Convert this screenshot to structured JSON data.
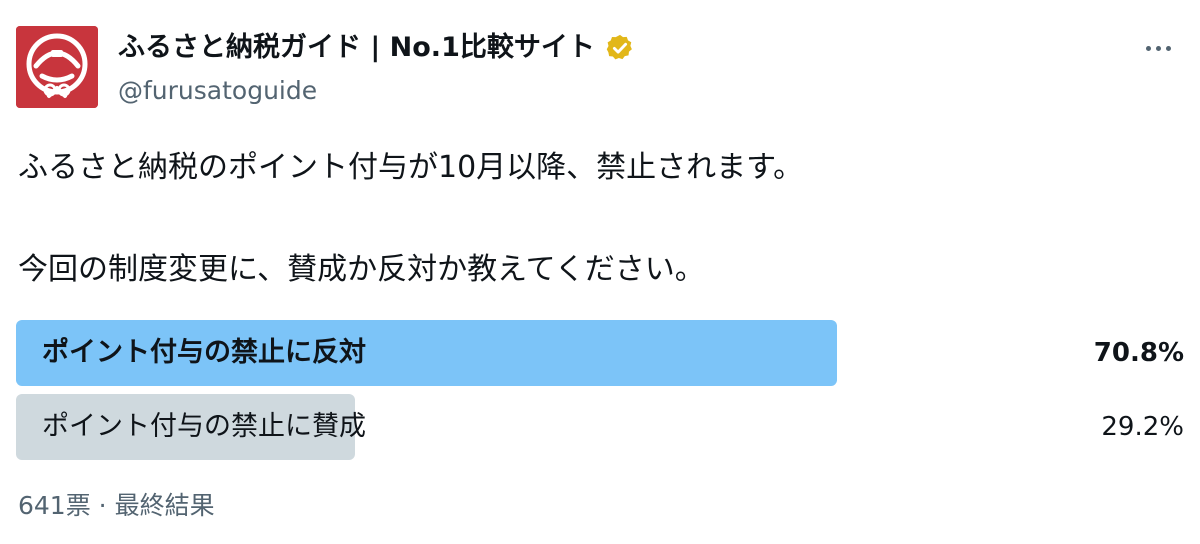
{
  "account": {
    "display_name": "ふるさと納税ガイド | No.1比較サイト",
    "handle": "@furusatoguide",
    "verified": true,
    "verified_color": "#e2b719",
    "avatar_color": "#c8353d",
    "avatar_icon": "furusato-guide-logo"
  },
  "tweet": {
    "line1": "ふるさと納税のポイント付与が10月以降、禁止されます。",
    "line2": "今回の制度変更に、賛成か反対か教えてください。"
  },
  "poll": {
    "options": [
      {
        "label": "ポイント付与の禁止に反対",
        "percent_text": "70.8%",
        "share": 0.708,
        "winner": true,
        "bar_color": "#7cc4f8"
      },
      {
        "label": "ポイント付与の禁止に賛成",
        "percent_text": "29.2%",
        "share": 0.292,
        "winner": false,
        "bar_color": "#cfd9de"
      }
    ],
    "votes": "641票",
    "separator": "·",
    "status": "最終結果"
  },
  "colors": {
    "text": "#0f1419",
    "secondary": "#536471"
  }
}
